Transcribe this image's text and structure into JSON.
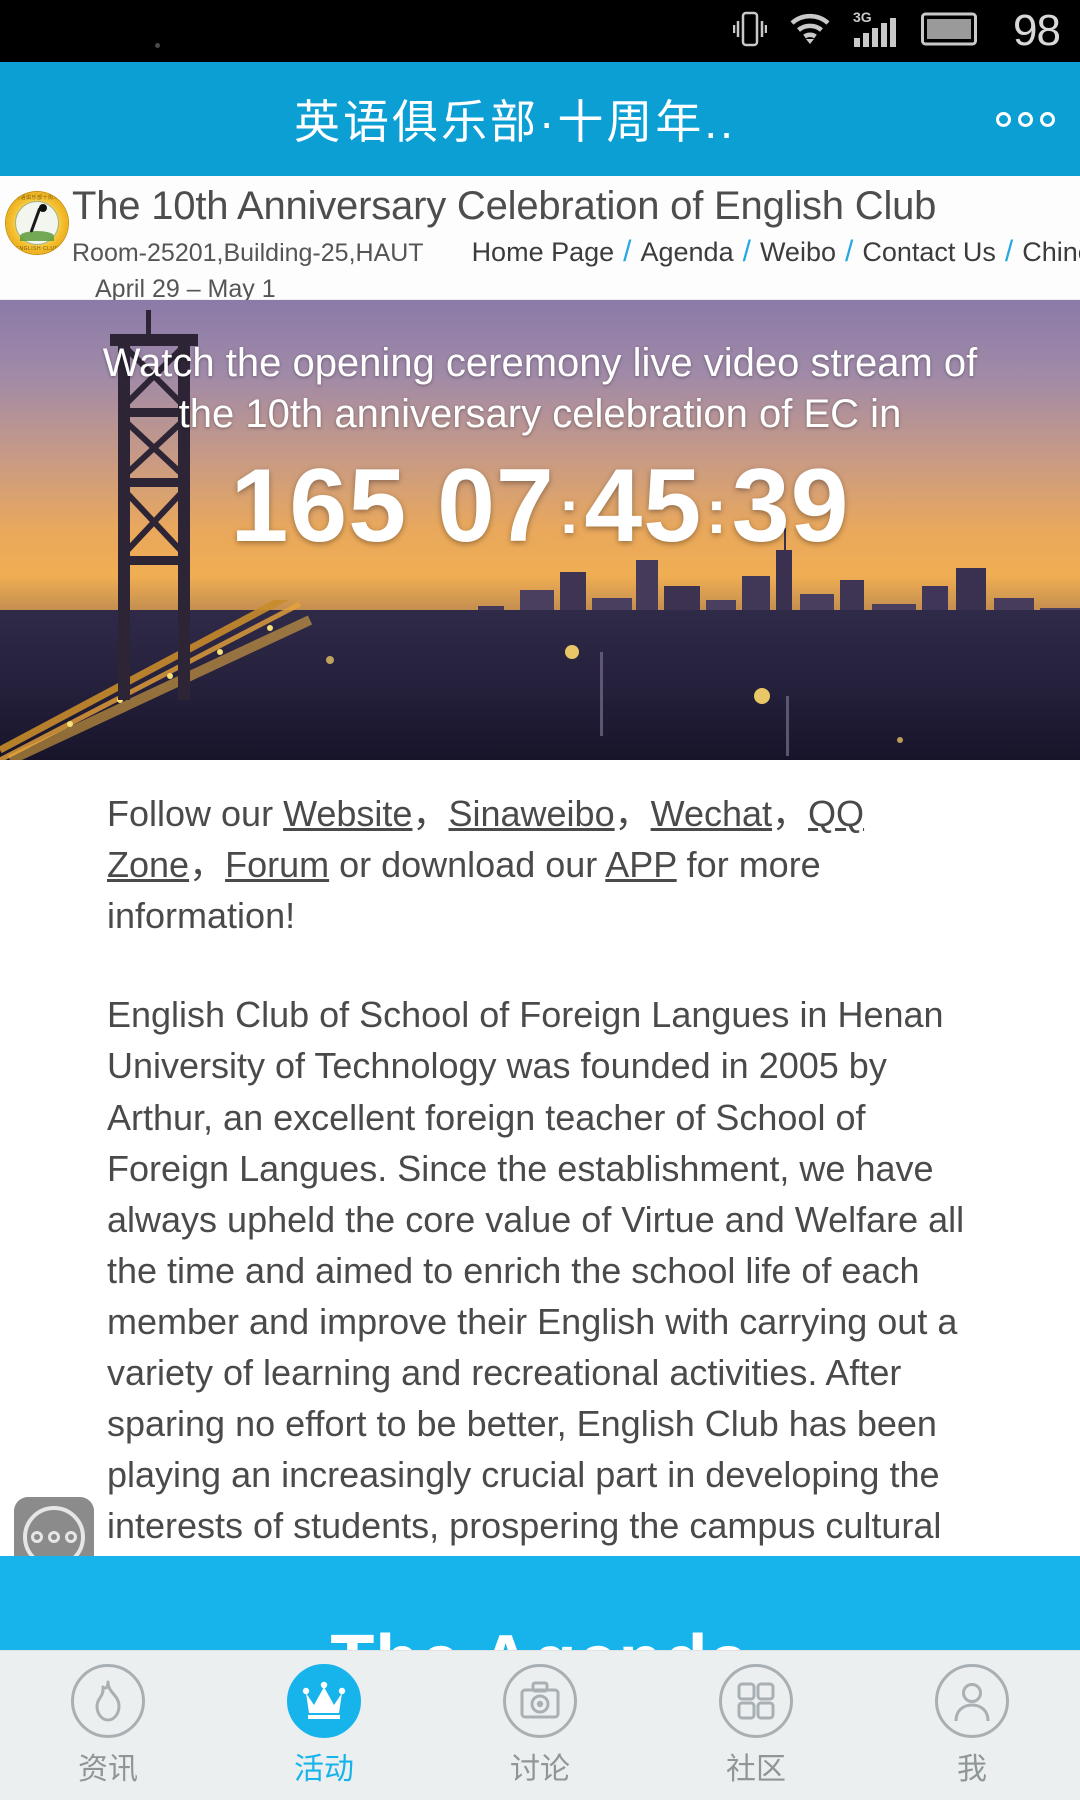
{
  "status_bar": {
    "battery_percent": "98",
    "network": "3G",
    "icons": [
      "vibrate-icon",
      "wifi-icon",
      "signal-icon",
      "battery-icon"
    ]
  },
  "app_bar": {
    "title": "英语俱乐部·十周年..",
    "more_label": "000",
    "accent_color": "#0c9fd4"
  },
  "site_header": {
    "logo_top_text": "英语俱乐部十周年",
    "logo_bottom_text": "ENGLISH CLUB",
    "title": "The 10th Anniversary Celebration of English Club",
    "address": "Room-25201,Building-25,HAUT",
    "dates": "April 29 – May 1",
    "nav": [
      {
        "label": "Home Page"
      },
      {
        "label": "Agenda"
      },
      {
        "label": "Weibo"
      },
      {
        "label": "Contact Us"
      },
      {
        "label": "Chinese"
      }
    ],
    "nav_separator": "/"
  },
  "hero": {
    "headline": "Watch the opening ceremony live video stream of the 10th anniversary celebration of EC in",
    "countdown": {
      "days": "165",
      "hours": "07",
      "minutes": "45",
      "seconds": "39",
      "separator": ":"
    }
  },
  "content": {
    "follow_prefix": "Follow our ",
    "follow_links": [
      "Website",
      "Sinaweibo",
      "Wechat",
      "QQ Zone",
      "Forum"
    ],
    "follow_comma": "，",
    "follow_middle": " or download our ",
    "app_link": "APP",
    "follow_suffix": " for more information!",
    "about": "English Club of School of Foreign Langues in Henan University of Technology was founded in 2005 by Arthur, an excellent foreign teacher of School of Foreign Langues. Since the establishment, we have always upheld the core value of Virtue and Welfare all the time and aimed to enrich the school life of each member and improve their English with carrying out a variety of learning and recreational activities. After sparing no effort to be better, English Club has been playing an increasingly crucial part in developing the interests of students, prospering the campus cultural life and improving students' comprehensive qualities."
  },
  "floating_button": {
    "label": "more-options"
  },
  "blue_strip": {
    "clipped_text": "The Agenda"
  },
  "tab_bar": {
    "active_index": 1,
    "items": [
      {
        "label": "资讯",
        "icon": "flame-icon"
      },
      {
        "label": "活动",
        "icon": "crown-icon"
      },
      {
        "label": "讨论",
        "icon": "camera-icon"
      },
      {
        "label": "社区",
        "icon": "grid-icon"
      },
      {
        "label": "我",
        "icon": "person-icon"
      }
    ],
    "accent_color": "#17b4ec"
  }
}
